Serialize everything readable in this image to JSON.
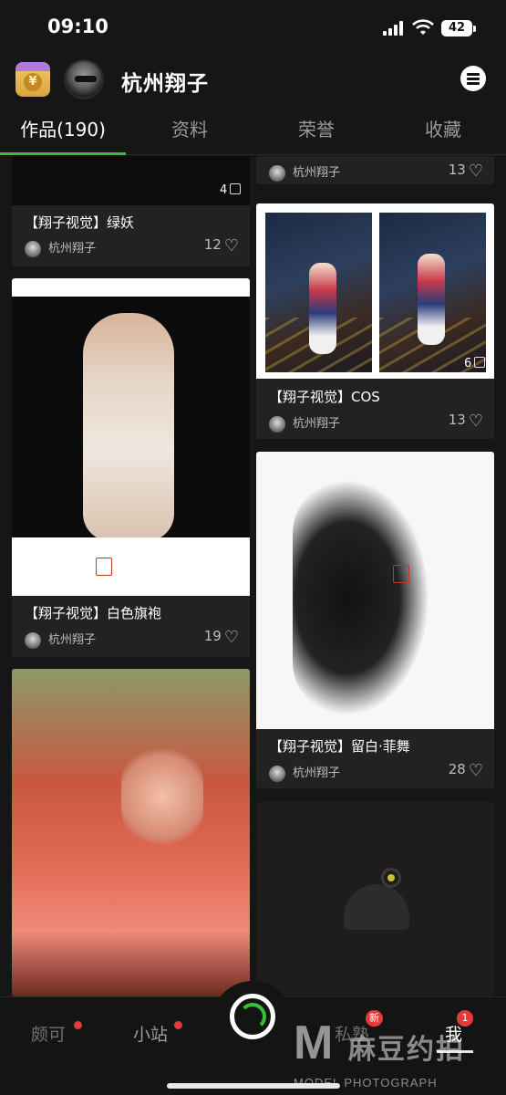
{
  "status": {
    "time": "09:10",
    "battery": "42"
  },
  "header": {
    "name": "杭州翔子"
  },
  "tabs": [
    {
      "label": "作品(190)",
      "active": true
    },
    {
      "label": "资料",
      "active": false
    },
    {
      "label": "荣誉",
      "active": false
    },
    {
      "label": "收藏",
      "active": false
    }
  ],
  "cards": {
    "top_right": {
      "author": "杭州翔子",
      "likes": "13"
    },
    "green": {
      "count": "4",
      "title": "【翔子视觉】绿妖",
      "author": "杭州翔子",
      "likes": "12"
    },
    "cos": {
      "count": "6",
      "title": "【翔子视觉】COS",
      "author": "杭州翔子",
      "likes": "13"
    },
    "qipao": {
      "title": "【翔子视觉】白色旗袍",
      "author": "杭州翔子",
      "likes": "19"
    },
    "dance": {
      "title": "【翔子视觉】留白·菲舞",
      "author": "杭州翔子",
      "likes": "28"
    }
  },
  "heart_glyph": "♡",
  "nav": {
    "items": [
      {
        "label": "颇可"
      },
      {
        "label": "小站"
      },
      {
        "label": "私塾",
        "badge": "新"
      },
      {
        "label": "我",
        "badge": "1"
      }
    ]
  },
  "watermark": {
    "logo": "M",
    "text": "麻豆约拍",
    "sub": "MODEL PHOTOGRAPH"
  },
  "colors": {
    "accent_green": "#3bbd3b",
    "badge_red": "#e33a3a",
    "background": "#161616"
  }
}
